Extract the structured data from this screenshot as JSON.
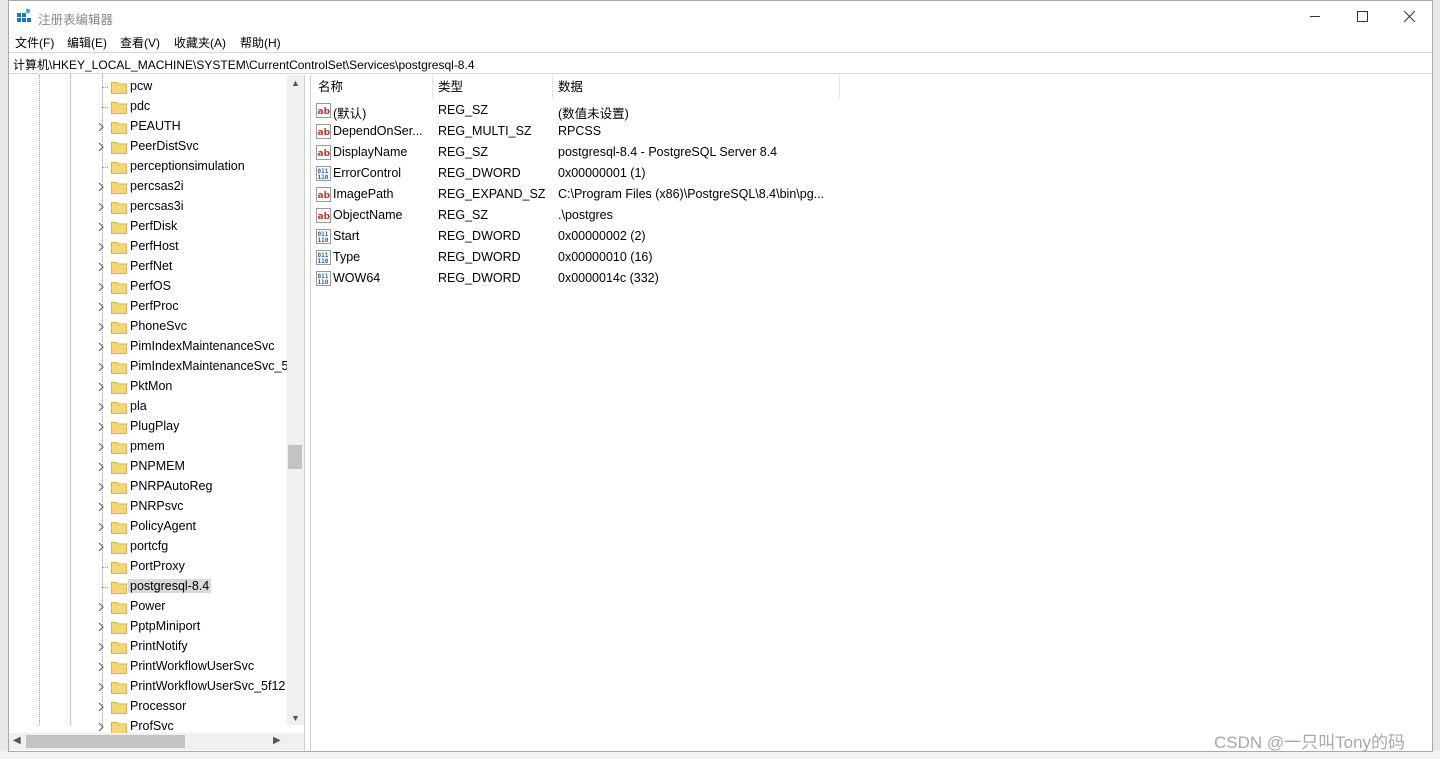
{
  "window": {
    "title": "注册表编辑器",
    "minimize_glyph": "minimize",
    "maximize_glyph": "maximize",
    "close_glyph": "close"
  },
  "menu": [
    "文件(F)",
    "编辑(E)",
    "查看(V)",
    "收藏夹(A)",
    "帮助(H)"
  ],
  "address": "计算机\\HKEY_LOCAL_MACHINE\\SYSTEM\\CurrentControlSet\\Services\\postgresql-8.4",
  "tree": {
    "items": [
      {
        "label": "pcw",
        "expandable": false
      },
      {
        "label": "pdc",
        "expandable": false
      },
      {
        "label": "PEAUTH",
        "expandable": true
      },
      {
        "label": "PeerDistSvc",
        "expandable": true
      },
      {
        "label": "perceptionsimulation",
        "expandable": false
      },
      {
        "label": "percsas2i",
        "expandable": true
      },
      {
        "label": "percsas3i",
        "expandable": true
      },
      {
        "label": "PerfDisk",
        "expandable": true
      },
      {
        "label": "PerfHost",
        "expandable": true
      },
      {
        "label": "PerfNet",
        "expandable": true
      },
      {
        "label": "PerfOS",
        "expandable": true
      },
      {
        "label": "PerfProc",
        "expandable": true
      },
      {
        "label": "PhoneSvc",
        "expandable": true
      },
      {
        "label": "PimIndexMaintenanceSvc",
        "expandable": true
      },
      {
        "label": "PimIndexMaintenanceSvc_5",
        "expandable": true
      },
      {
        "label": "PktMon",
        "expandable": true
      },
      {
        "label": "pla",
        "expandable": true
      },
      {
        "label": "PlugPlay",
        "expandable": true
      },
      {
        "label": "pmem",
        "expandable": true
      },
      {
        "label": "PNPMEM",
        "expandable": true
      },
      {
        "label": "PNRPAutoReg",
        "expandable": true
      },
      {
        "label": "PNRPsvc",
        "expandable": true
      },
      {
        "label": "PolicyAgent",
        "expandable": true
      },
      {
        "label": "portcfg",
        "expandable": true
      },
      {
        "label": "PortProxy",
        "expandable": false
      },
      {
        "label": "postgresql-8.4",
        "expandable": false,
        "selected": true
      },
      {
        "label": "Power",
        "expandable": true
      },
      {
        "label": "PptpMiniport",
        "expandable": true
      },
      {
        "label": "PrintNotify",
        "expandable": true
      },
      {
        "label": "PrintWorkflowUserSvc",
        "expandable": true
      },
      {
        "label": "PrintWorkflowUserSvc_5f12",
        "expandable": true
      },
      {
        "label": "Processor",
        "expandable": true
      },
      {
        "label": "ProfSvc",
        "expandable": true
      }
    ]
  },
  "list": {
    "columns": [
      "名称",
      "类型",
      "数据"
    ],
    "rows": [
      {
        "icon": "string-value-icon",
        "name": "(默认)",
        "type": "REG_SZ",
        "data": "(数值未设置)"
      },
      {
        "icon": "string-value-icon",
        "name": "DependOnSer...",
        "type": "REG_MULTI_SZ",
        "data": "RPCSS"
      },
      {
        "icon": "string-value-icon",
        "name": "DisplayName",
        "type": "REG_SZ",
        "data": "postgresql-8.4 - PostgreSQL Server 8.4"
      },
      {
        "icon": "binary-value-icon",
        "name": "ErrorControl",
        "type": "REG_DWORD",
        "data": "0x00000001 (1)"
      },
      {
        "icon": "string-value-icon",
        "name": "ImagePath",
        "type": "REG_EXPAND_SZ",
        "data": "C:\\Program Files (x86)\\PostgreSQL\\8.4\\bin\\pg..."
      },
      {
        "icon": "string-value-icon",
        "name": "ObjectName",
        "type": "REG_SZ",
        "data": ".\\postgres"
      },
      {
        "icon": "binary-value-icon",
        "name": "Start",
        "type": "REG_DWORD",
        "data": "0x00000002 (2)"
      },
      {
        "icon": "binary-value-icon",
        "name": "Type",
        "type": "REG_DWORD",
        "data": "0x00000010 (16)"
      },
      {
        "icon": "binary-value-icon",
        "name": "WOW64",
        "type": "REG_DWORD",
        "data": "0x0000014c (332)"
      }
    ]
  },
  "watermark": "CSDN @一只叫Tony的码",
  "colors": {
    "selection": "#d9d9d9",
    "folder": "#f5d77a",
    "string_icon": "#c0392b",
    "binary_icon": "#2b5fa8"
  }
}
